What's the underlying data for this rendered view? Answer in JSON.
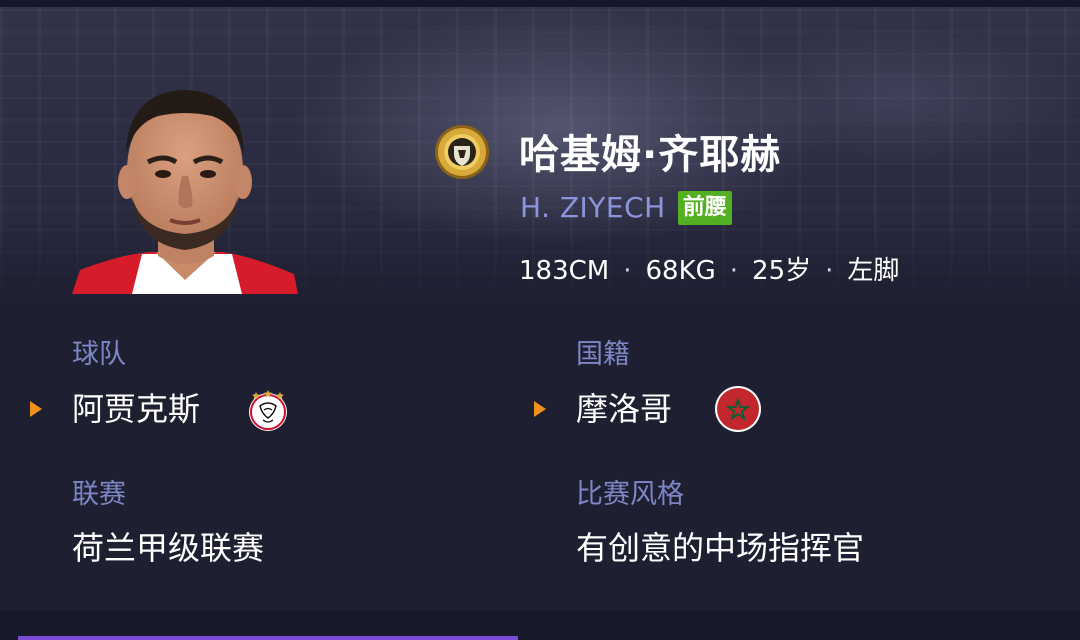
{
  "player": {
    "name_cn": "哈基姆·齐耶赫",
    "name_en": "H. ZIYECH",
    "position": "前腰",
    "height": "183CM",
    "weight": "68KG",
    "age": "25岁",
    "foot": "左脚",
    "separator": "·"
  },
  "fields": {
    "team": {
      "label": "球队",
      "value": "阿贾克斯"
    },
    "nationality": {
      "label": "国籍",
      "value": "摩洛哥"
    },
    "league": {
      "label": "联赛",
      "value": "荷兰甲级联赛"
    },
    "style": {
      "label": "比赛风格",
      "value": "有创意的中场指挥官"
    }
  },
  "icons": {
    "badge": "gold-tier-badge-icon",
    "arrow": "orange-arrow-icon",
    "team_crest": "ajax-crest-icon",
    "flag": "morocco-flag-icon"
  },
  "colors": {
    "background": "#1e1f31",
    "label": "#7e87c6",
    "english_name": "#8b94dc",
    "position_tag": "#52b021",
    "arrow": "#f0921e",
    "accent": "#7c4ad6"
  }
}
